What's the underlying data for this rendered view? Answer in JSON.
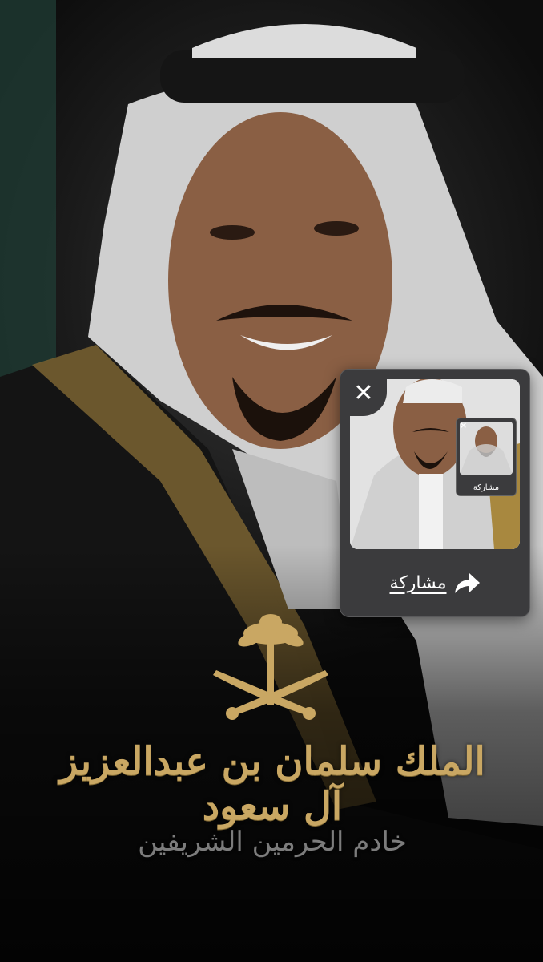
{
  "background": {
    "title_line": "الملك سلمان بن عبدالعزيز آل سعود",
    "subtitle_line": "خادم الحرمين الشريفين"
  },
  "share_card": {
    "close_glyph": "✕",
    "share_label": "مشاركة",
    "share_icon": "share-arrow-icon",
    "mini_card": {
      "close_glyph": "×",
      "share_label": "مشاركة"
    }
  },
  "colors": {
    "gold": "#c9a763",
    "card_bg": "#3b3b3d",
    "subtitle": "#7c7c7c"
  }
}
